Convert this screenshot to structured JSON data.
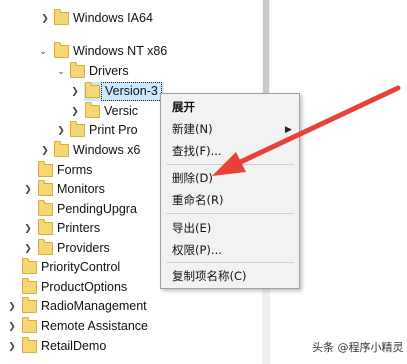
{
  "tree": {
    "rows": [
      {
        "label": "Windows IA64",
        "state": "collapsed"
      },
      {
        "label": "Windows NT x86",
        "state": "expanded"
      },
      {
        "label": "Drivers",
        "state": "expanded"
      },
      {
        "label": "Version-3",
        "state": "collapsed",
        "selected": true
      },
      {
        "label": "Versic",
        "state": "collapsed"
      },
      {
        "label": "Print Pro",
        "state": "collapsed"
      },
      {
        "label": "Windows x6",
        "state": "collapsed"
      },
      {
        "label": "Forms",
        "state": "none"
      },
      {
        "label": "Monitors",
        "state": "collapsed"
      },
      {
        "label": "PendingUpgra",
        "state": "none"
      },
      {
        "label": "Printers",
        "state": "collapsed"
      },
      {
        "label": "Providers",
        "state": "collapsed"
      },
      {
        "label": "PriorityControl",
        "state": "none"
      },
      {
        "label": "ProductOptions",
        "state": "none"
      },
      {
        "label": "RadioManagement",
        "state": "collapsed"
      },
      {
        "label": "Remote Assistance",
        "state": "collapsed"
      },
      {
        "label": "RetailDemo",
        "state": "collapsed"
      }
    ]
  },
  "context_menu": {
    "items": [
      {
        "label": "展开",
        "bold": true
      },
      {
        "label": "新建(N)",
        "has_submenu": true
      },
      {
        "label": "查找(F)..."
      },
      {
        "label": "删除(D)"
      },
      {
        "label": "重命名(R)"
      },
      {
        "label": "导出(E)"
      },
      {
        "label": "权限(P)..."
      },
      {
        "label": "复制项名称(C)"
      }
    ]
  },
  "annotation": {
    "color": "#e8413a",
    "icon": "red-arrow-pointing-to-delete"
  },
  "watermark": {
    "text": "头条 @程序小精灵"
  }
}
